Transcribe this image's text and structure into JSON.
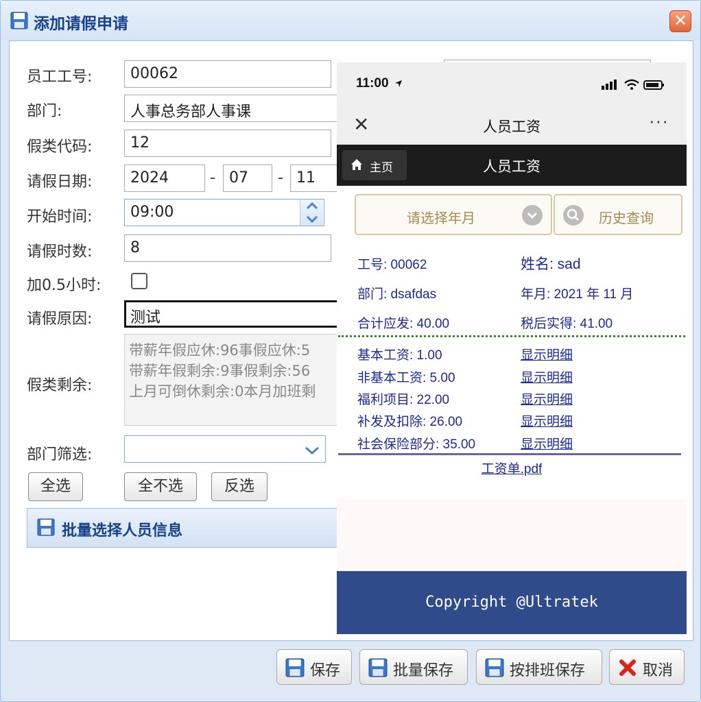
{
  "dialog": {
    "title": "添加请假申请",
    "close_glyph": "✕"
  },
  "form": {
    "emp_no_label": "员工工号:",
    "emp_no_value": "00062",
    "dept_label": "部门:",
    "dept_value": "人事总务部人事课",
    "leave_code_label": "假类代码:",
    "leave_code_value": "12",
    "leave_date_label": "请假日期:",
    "year_value": "2024",
    "month_value": "07",
    "day_value": "11",
    "date_sep": "-",
    "start_time_label": "开始时间:",
    "start_time_value": "09:00",
    "hours_label": "请假时数:",
    "hours_value": "8",
    "half_hour_label": "加0.5小时:",
    "reason_label": "请假原因:",
    "reason_value": "测试",
    "remain_label": "假类剩余:",
    "remain_lines": [
      "带薪年假应休:96事假应休:5",
      "带薪年假剩余:9事假剩余:56",
      "上月可倒休剩余:0本月加班剩"
    ],
    "dept_filter_label": "部门筛选:",
    "dept_filter_value": ""
  },
  "buttons": {
    "select_all": "全选",
    "select_none": "全不选",
    "invert": "反选"
  },
  "section": {
    "title": "批量选择人员信息"
  },
  "footer_buttons": {
    "save": "保存",
    "batch_save": "批量保存",
    "schedule_save": "按排班保存",
    "cancel": "取消"
  },
  "phone": {
    "status_time": "11:00",
    "nav_title": "人员工资",
    "nav_close": "✕",
    "nav_more": "···",
    "home_label": "主页",
    "header_title": "人员工资",
    "year_month_select": "请选择年月",
    "history_button": "历史查询",
    "emp_no": "工号: 00062",
    "name": "姓名: sad",
    "dept": "部门: dsafdas",
    "year_month": "年月: 2021 年 11 月",
    "total_gross": "合计应发: 40.00",
    "net_pay": "税后实得: 41.00",
    "pay_items": [
      {
        "label": "基本工资: 1.00",
        "link": "显示明细"
      },
      {
        "label": "非基本工资: 5.00",
        "link": "显示明细"
      },
      {
        "label": "福利项目: 22.00",
        "link": "显示明细"
      },
      {
        "label": "补发及扣除: 26.00",
        "link": "显示明细"
      },
      {
        "label": "社会保险部分: 35.00",
        "link": "显示明细"
      }
    ],
    "pdf_link": "工资单.pdf",
    "copyright": "Copyright @Ultratek"
  },
  "colors": {
    "accent": "#15428b",
    "footer_bg": "#2f4b8a",
    "link_blue": "#1c2a96"
  }
}
